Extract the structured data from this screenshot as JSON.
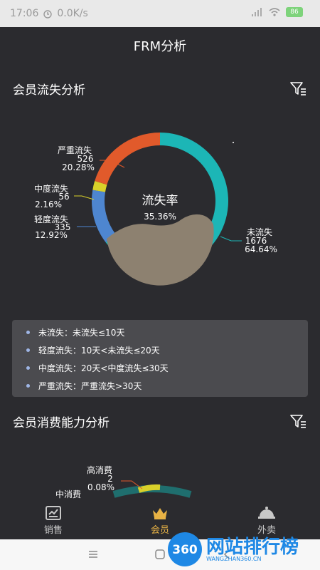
{
  "status_bar": {
    "time": "17:06",
    "speed": "0.0K/s",
    "battery": "86"
  },
  "app_bar": {
    "title": "FRM分析"
  },
  "section1": {
    "title": "会员流失分析",
    "icon": "filter-icon"
  },
  "donut": {
    "center_label": "流失率",
    "center_value": "35.36%",
    "segments": [
      {
        "name": "未流失",
        "count": "1676",
        "percent": "64.64%",
        "value": 64.64,
        "color": "#1cb6b6"
      },
      {
        "name": "轻度流失",
        "count": "335",
        "percent": "12.92%",
        "value": 12.92,
        "color": "#4e86d0"
      },
      {
        "name": "中度流失",
        "count": "56",
        "percent": "2.16%",
        "value": 2.16,
        "color": "#d9d12a"
      },
      {
        "name": "严重流失",
        "count": "526",
        "percent": "20.28%",
        "value": 20.28,
        "color": "#e15a2b"
      }
    ],
    "fill_color": "#8d8170"
  },
  "legend": {
    "items": [
      "未流失：未流失≤10天",
      "轻度流失：10天<未流失≤20天",
      "中度流失：20天<中度流失≤30天",
      "严重流失：严重流失>30天"
    ]
  },
  "section2": {
    "title": "会员消费能力分析",
    "icon": "filter-icon"
  },
  "consumption": {
    "high_label": "高消费",
    "high_count": "2",
    "high_percent": "0.08%",
    "mid_label": "中消费"
  },
  "tabs": [
    {
      "label": "销售",
      "icon": "sales-icon"
    },
    {
      "label": "会员",
      "icon": "crown-icon"
    },
    {
      "label": "外卖",
      "icon": "cloche-icon"
    }
  ],
  "watermark": {
    "title": "网站排行榜",
    "sub": "WANGZHAN360.CN",
    "badge": "360"
  }
}
